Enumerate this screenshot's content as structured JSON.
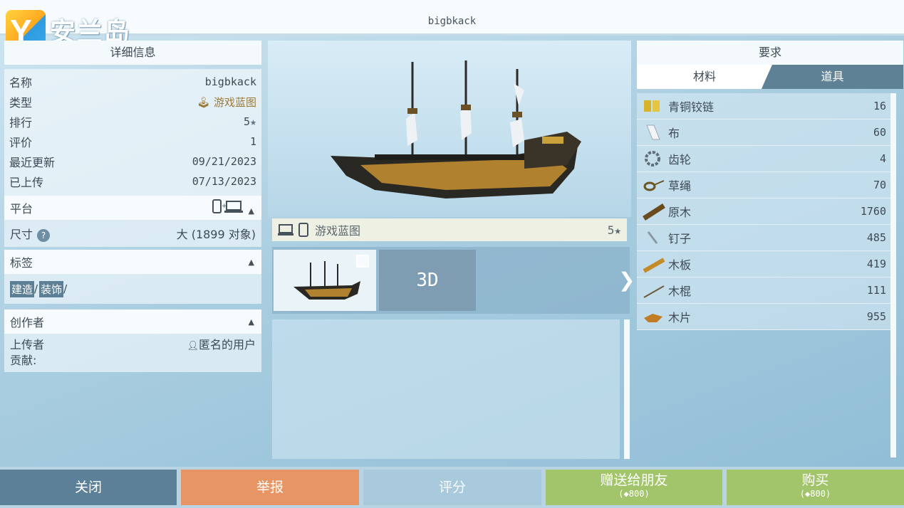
{
  "app": {
    "title": "bigbkack",
    "logo_text": "安兰岛",
    "logo_letter": "Y"
  },
  "details": {
    "header": "详细信息",
    "rows": [
      {
        "label": "名称",
        "value": "bigbkack"
      },
      {
        "label": "类型",
        "value": "游戏蓝图"
      },
      {
        "label": "排行",
        "value": "5"
      },
      {
        "label": "评价",
        "value": "1"
      },
      {
        "label": "最近更新",
        "value": "09/21/2023"
      },
      {
        "label": "已上传",
        "value": "07/13/2023"
      }
    ],
    "platform_label": "平台",
    "size_label": "尺寸",
    "size_value": "大 (1899 对象)",
    "tags_label": "标签",
    "tags": [
      "建造",
      "装饰"
    ],
    "creator_label": "创作者",
    "uploader_label": "上传者",
    "uploader_value": "匿名的用户",
    "contribution_label": "贡献:"
  },
  "preview": {
    "type_label": "游戏蓝图",
    "rating": "5",
    "view_3d_label": "3D"
  },
  "requirements": {
    "header": "要求",
    "tab_materials": "材料",
    "tab_tools": "道具",
    "materials": [
      {
        "name": "青铜铰链",
        "count": "16",
        "icon": "hinge-icon"
      },
      {
        "name": "布",
        "count": "60",
        "icon": "cloth-icon"
      },
      {
        "name": "齿轮",
        "count": "4",
        "icon": "gear-icon"
      },
      {
        "name": "草绳",
        "count": "70",
        "icon": "rope-icon"
      },
      {
        "name": "原木",
        "count": "1760",
        "icon": "log-icon"
      },
      {
        "name": "钉子",
        "count": "485",
        "icon": "nail-icon"
      },
      {
        "name": "木板",
        "count": "419",
        "icon": "plank-icon"
      },
      {
        "name": "木棍",
        "count": "111",
        "icon": "stick-icon"
      },
      {
        "name": "木片",
        "count": "955",
        "icon": "wood-chip-icon"
      }
    ]
  },
  "buttons": {
    "close": "关闭",
    "report": "举报",
    "rate": "评分",
    "gift": "赠送给朋友",
    "gift_price": "800",
    "buy": "购买",
    "buy_price": "800"
  },
  "colors": {
    "accent_dark": "#5d8099",
    "report": "#e89565",
    "buy_green": "#a2c46a",
    "gold": "#9c7a3a"
  }
}
